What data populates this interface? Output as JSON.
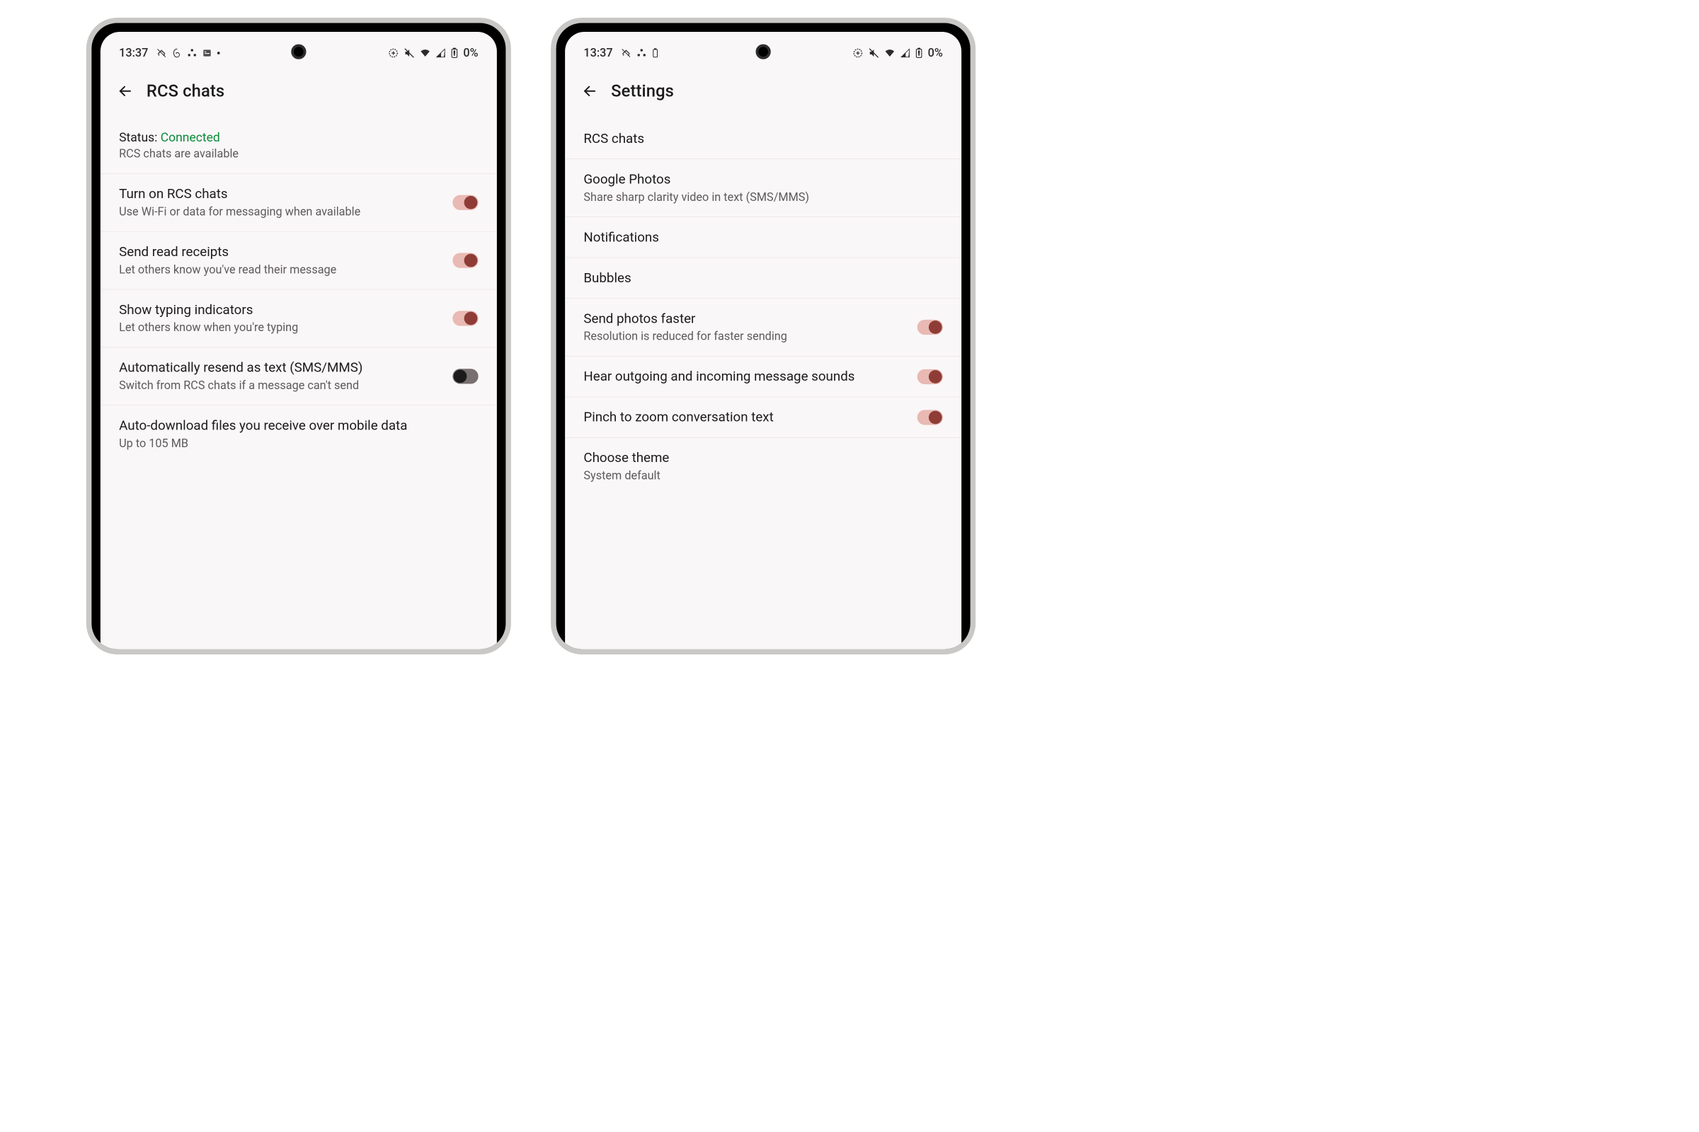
{
  "statusbar": {
    "time": "13:37",
    "battery": "0%"
  },
  "phone1": {
    "title": "RCS chats",
    "status_label": "Status: ",
    "status_value": "Connected",
    "status_sub": "RCS chats are available",
    "items": [
      {
        "title": "Turn on RCS chats",
        "sub": "Use Wi-Fi or data for messaging when available",
        "toggle": "on"
      },
      {
        "title": "Send read receipts",
        "sub": "Let others know you've read their message",
        "toggle": "on"
      },
      {
        "title": "Show typing indicators",
        "sub": "Let others know when you're typing",
        "toggle": "on"
      },
      {
        "title": "Automatically resend as text (SMS/MMS)",
        "sub": "Switch from RCS chats if a message can't send",
        "toggle": "off"
      },
      {
        "title": "Auto-download files you receive over mobile data",
        "sub": "Up to 105 MB",
        "toggle": "none"
      }
    ]
  },
  "phone2": {
    "title": "Settings",
    "items": [
      {
        "title": "RCS chats",
        "sub": "",
        "toggle": "none"
      },
      {
        "title": "Google Photos",
        "sub": "Share sharp clarity video in text (SMS/MMS)",
        "toggle": "none"
      },
      {
        "title": "Notifications",
        "sub": "",
        "toggle": "none"
      },
      {
        "title": "Bubbles",
        "sub": "",
        "toggle": "none"
      },
      {
        "title": "Send photos faster",
        "sub": "Resolution is reduced for faster sending",
        "toggle": "on"
      },
      {
        "title": "Hear outgoing and incoming message sounds",
        "sub": "",
        "toggle": "on"
      },
      {
        "title": "Pinch to zoom conversation text",
        "sub": "",
        "toggle": "on"
      },
      {
        "title": "Choose theme",
        "sub": "System default",
        "toggle": "none"
      }
    ]
  }
}
